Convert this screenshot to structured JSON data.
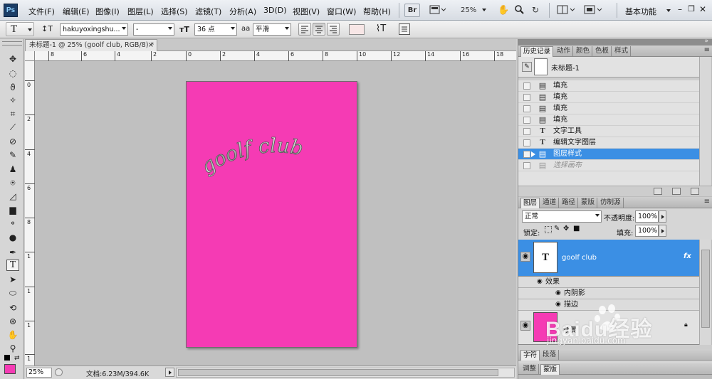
{
  "app": {
    "logo_text": "Ps"
  },
  "menu": {
    "items": [
      "文件(F)",
      "编辑(E)",
      "图像(I)",
      "图层(L)",
      "选择(S)",
      "滤镜(T)",
      "分析(A)",
      "3D(D)",
      "视图(V)",
      "窗口(W)",
      "帮助(H)"
    ],
    "bridge_label": "Br",
    "zoom_value": "25%",
    "workspace_label": "基本功能"
  },
  "options": {
    "tool_glyph": "T",
    "font_family": "hakuyoxingshu...",
    "font_style": "-",
    "font_size": "36 点",
    "aa_label": "aa",
    "antialias": "平滑"
  },
  "document": {
    "tab_title": "未标题-1 @ 25% (goolf club, RGB/8) *",
    "canvas_color": "#f53bb4",
    "text_content": "goolf club",
    "ruler_top": [
      "8",
      "6",
      "4",
      "2",
      "0",
      "2",
      "4",
      "6",
      "8",
      "10",
      "12",
      "14",
      "16",
      "18"
    ],
    "ruler_left": [
      "0",
      "2",
      "4",
      "6",
      "8",
      "1",
      "1",
      "1",
      "1"
    ]
  },
  "status": {
    "zoom": "25%",
    "doc_info": "文档:6.23M/394.6K"
  },
  "history_panel": {
    "tabs": [
      "历史记录",
      "动作",
      "颜色",
      "色板",
      "样式"
    ],
    "snapshot_label": "未标题-1",
    "items": [
      {
        "icon": "fill-icon",
        "glyph": "▤",
        "label": "填充"
      },
      {
        "icon": "fill-icon",
        "glyph": "▤",
        "label": "填充"
      },
      {
        "icon": "fill-icon",
        "glyph": "▤",
        "label": "填充"
      },
      {
        "icon": "fill-icon",
        "glyph": "▤",
        "label": "填充"
      },
      {
        "icon": "type-icon",
        "glyph": "T",
        "label": "文字工具"
      },
      {
        "icon": "type-icon",
        "glyph": "T",
        "label": "编辑文字图层"
      },
      {
        "icon": "layer-style-icon",
        "glyph": "▤",
        "label": "图层样式"
      },
      {
        "icon": "select-canvas-icon",
        "glyph": "▤",
        "label": "选择画布"
      }
    ]
  },
  "layers_panel": {
    "tabs": [
      "图层",
      "通道",
      "路径",
      "蒙版",
      "仿制源"
    ],
    "blend_mode": "正常",
    "opacity_label": "不透明度:",
    "opacity_value": "100%",
    "lock_label": "锁定:",
    "fill_label": "填充:",
    "fill_value": "100%",
    "text_layer": {
      "name": "goolf club",
      "fx": "fx",
      "thumb_glyph": "T"
    },
    "effects_label": "效果",
    "effects": [
      "内阴影",
      "描边"
    ],
    "bg_layer_label": "背景",
    "bg_color": "#f53bb4"
  },
  "bottom_panels": {
    "char_tabs": [
      "字符",
      "段落"
    ],
    "adjust_tabs": [
      "调整",
      "蒙版"
    ]
  },
  "watermark": {
    "text": "Baidu经验",
    "url": "jingyan.baidu.com"
  }
}
